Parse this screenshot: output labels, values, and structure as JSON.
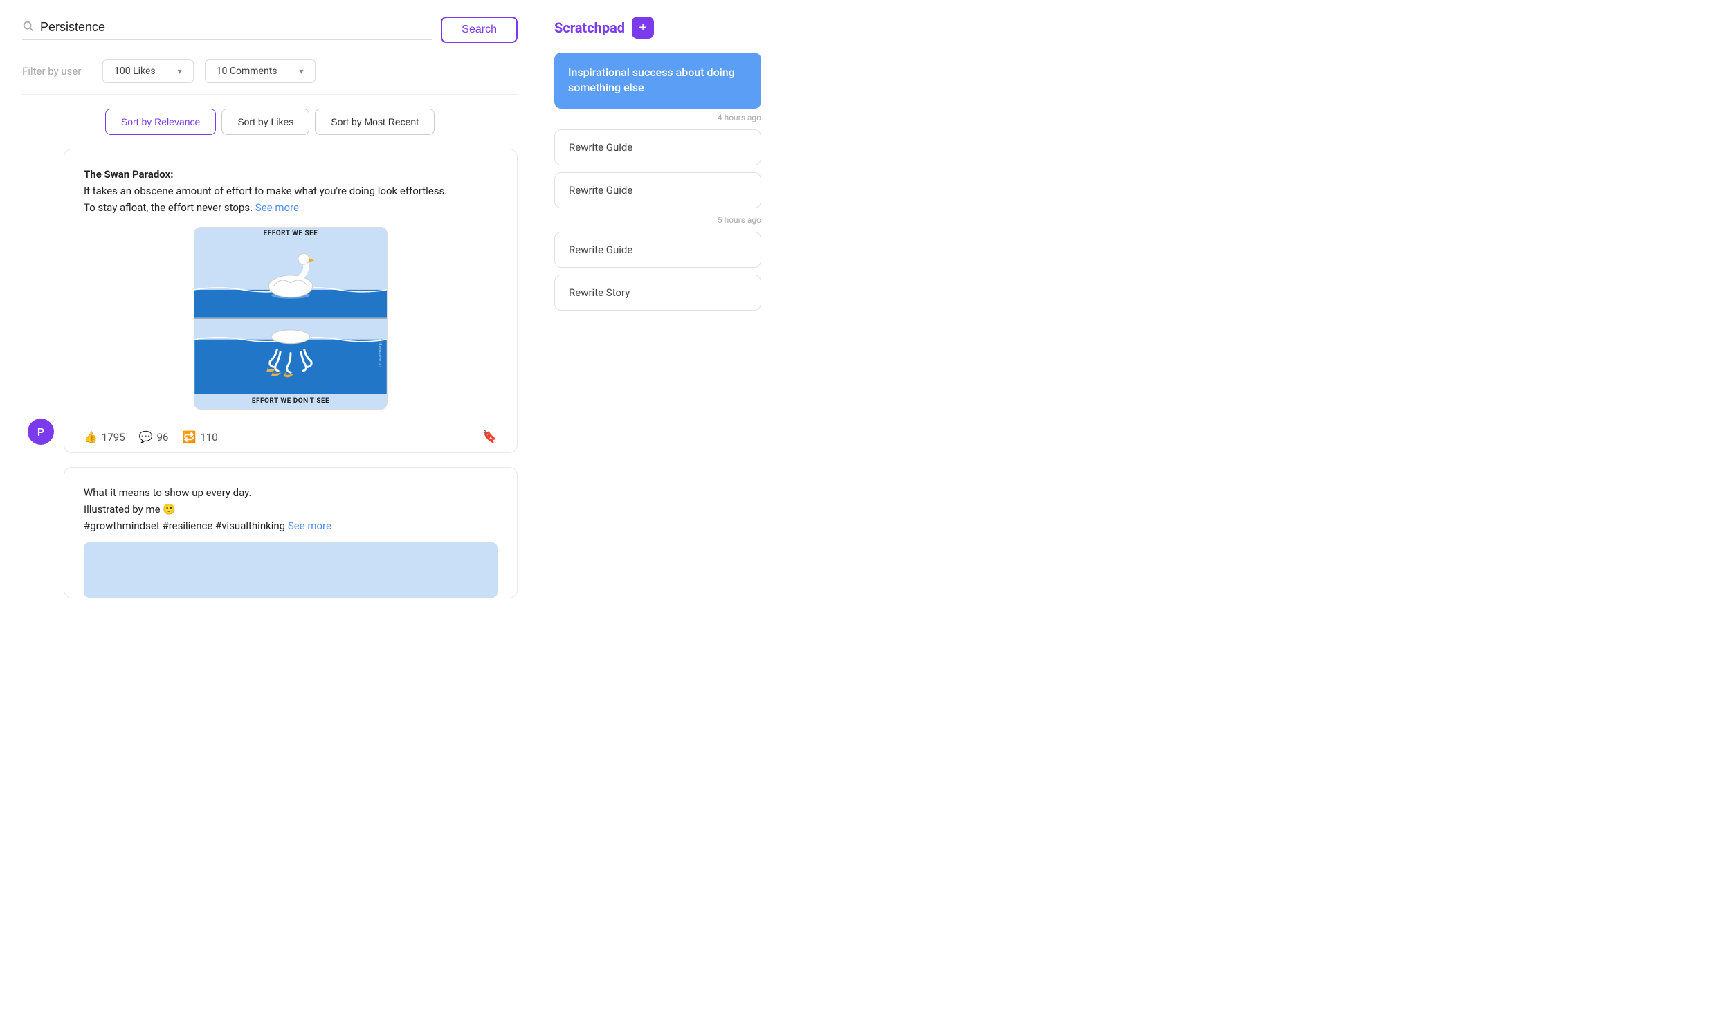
{
  "search": {
    "placeholder": "Persistence",
    "button_label": "Search",
    "icon": "search-icon"
  },
  "filters": {
    "user_placeholder": "Filter by user",
    "likes_label": "100 Likes",
    "comments_label": "10 Comments"
  },
  "sort": {
    "buttons": [
      {
        "label": "Sort by Relevance",
        "active": true
      },
      {
        "label": "Sort by Likes",
        "active": false
      },
      {
        "label": "Sort by Most Recent",
        "active": false
      }
    ]
  },
  "posts": [
    {
      "id": 1,
      "text_line1": "The Swan Paradox:",
      "text_line2": "It takes an obscene amount of effort to make what you're doing look effortless.",
      "text_line3": "To stay afloat, the effort never stops.",
      "see_more_label": "See more",
      "image_top_label": "EFFORT WE SEE",
      "image_bottom_label": "EFFORT WE DON'T SEE",
      "likes": "1795",
      "comments": "96",
      "shares": "110",
      "avatar_letter": "P"
    },
    {
      "id": 2,
      "text_line1": "What it means to show up every day.",
      "text_line2": "Illustrated by me 🙂",
      "text_line3": "#growthmindset #resilience #visualthinking",
      "see_more_label": "See more"
    }
  ],
  "scratchpad": {
    "title": "Scratchpad",
    "add_label": "+",
    "active_card": {
      "text": "Inspirational success about doing something else",
      "time": "4 hours ago"
    },
    "cards": [
      {
        "label": "Rewrite Guide",
        "group": "a"
      },
      {
        "label": "Rewrite Guide",
        "group": "a"
      },
      {
        "time": "5 hours ago"
      },
      {
        "label": "Rewrite Guide",
        "group": "b"
      },
      {
        "label": "Rewrite Story",
        "group": "b"
      }
    ]
  }
}
